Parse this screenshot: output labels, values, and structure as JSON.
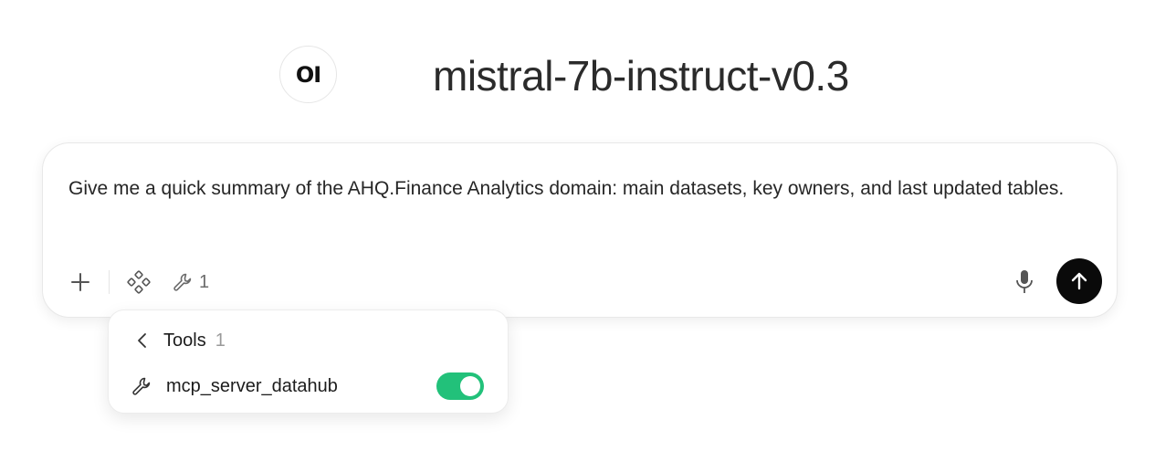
{
  "header": {
    "logo_text": "OI",
    "model_name": "mistral-7b-instruct-v0.3"
  },
  "composer": {
    "prompt_text": "Give me a quick summary of the AHQ.Finance Analytics domain: main datasets, key owners, and last updated tables.",
    "tools_count": "1",
    "icons": {
      "add": "plus-icon",
      "integrations": "integrations-icon",
      "tools": "wrench-icon",
      "mic": "microphone-icon",
      "send": "arrow-up-icon"
    },
    "send_button_color": "#0a0a0a"
  },
  "tools_popover": {
    "title": "Tools",
    "count": "1",
    "items": [
      {
        "name": "mcp_server_datahub",
        "enabled": true
      }
    ],
    "toggle_on_color": "#22c17a"
  }
}
